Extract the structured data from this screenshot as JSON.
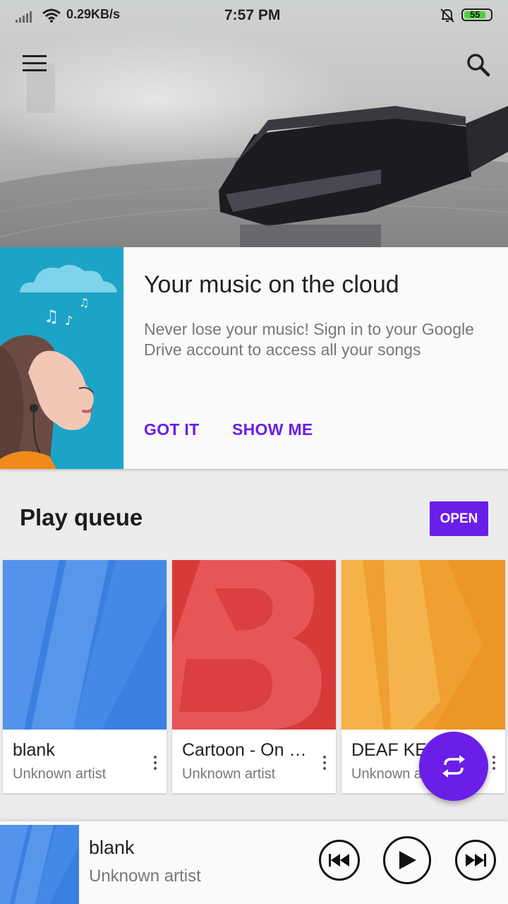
{
  "status_bar": {
    "speed": "0.29KB/s",
    "time": "7:57 PM",
    "battery": "55",
    "battery_color": "#4cd13a"
  },
  "top_bar": {
    "menu_icon": "hamburger-menu-icon",
    "search_icon": "search-icon"
  },
  "cloud_card": {
    "title": "Your music on the cloud",
    "description": "Never lose your music! Sign in to your Google Drive account to access all your songs",
    "got_it": "GOT IT",
    "show_me": "SHOW ME",
    "accent_color": "#6a1ee8",
    "art_bg_color": "#1ca3c8"
  },
  "play_queue": {
    "title": "Play queue",
    "open_label": "OPEN",
    "items": [
      {
        "title": "blank",
        "artist": "Unknown artist",
        "art_color": "#3b7fe0"
      },
      {
        "title": "Cartoon - On & On",
        "artist": "Unknown artist",
        "art_color": "#d83a3a"
      },
      {
        "title": "DEAF KEV",
        "artist": "Unknown artist",
        "art_color": "#f0a030"
      }
    ]
  },
  "fab": {
    "icon": "repeat-icon"
  },
  "player": {
    "title": "blank",
    "artist": "Unknown artist",
    "prev_icon": "skip-previous-icon",
    "play_icon": "play-icon",
    "next_icon": "skip-next-icon"
  }
}
